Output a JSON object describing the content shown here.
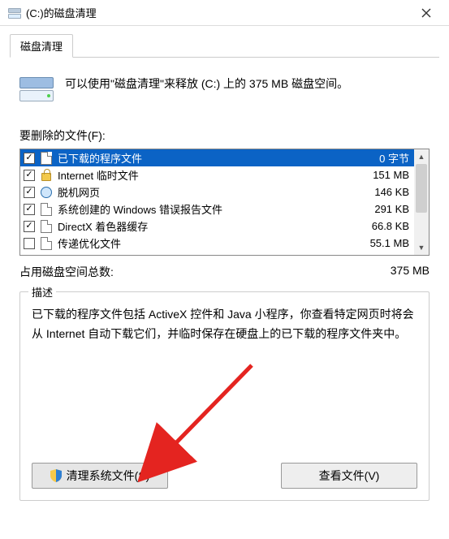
{
  "window": {
    "title": "(C:)的磁盘清理"
  },
  "tab": {
    "label": "磁盘清理"
  },
  "summary": "可以使用\"磁盘清理\"来释放  (C:) 上的 375 MB 磁盘空间。",
  "files_label": "要删除的文件(F):",
  "rows": [
    {
      "checked": true,
      "icon": "file",
      "name": "已下载的程序文件",
      "size": "0 字节",
      "selected": true
    },
    {
      "checked": true,
      "icon": "lock",
      "name": "Internet 临时文件",
      "size": "151 MB"
    },
    {
      "checked": true,
      "icon": "globe",
      "name": "脱机网页",
      "size": "146 KB"
    },
    {
      "checked": true,
      "icon": "file",
      "name": "系统创建的 Windows 错误报告文件",
      "size": "291 KB"
    },
    {
      "checked": true,
      "icon": "file",
      "name": "DirectX 着色器缓存",
      "size": "66.8 KB"
    },
    {
      "checked": false,
      "icon": "file",
      "name": "传递优化文件",
      "size": "55.1 MB"
    }
  ],
  "total": {
    "label": "占用磁盘空间总数:",
    "value": "375 MB"
  },
  "desc": {
    "legend": "描述",
    "text": "已下载的程序文件包括 ActiveX 控件和 Java 小程序，你查看特定网页时将会从 Internet 自动下载它们，并临时保存在硬盘上的已下载的程序文件夹中。"
  },
  "buttons": {
    "clean_system": "清理系统文件(S)",
    "view_files": "查看文件(V)"
  }
}
